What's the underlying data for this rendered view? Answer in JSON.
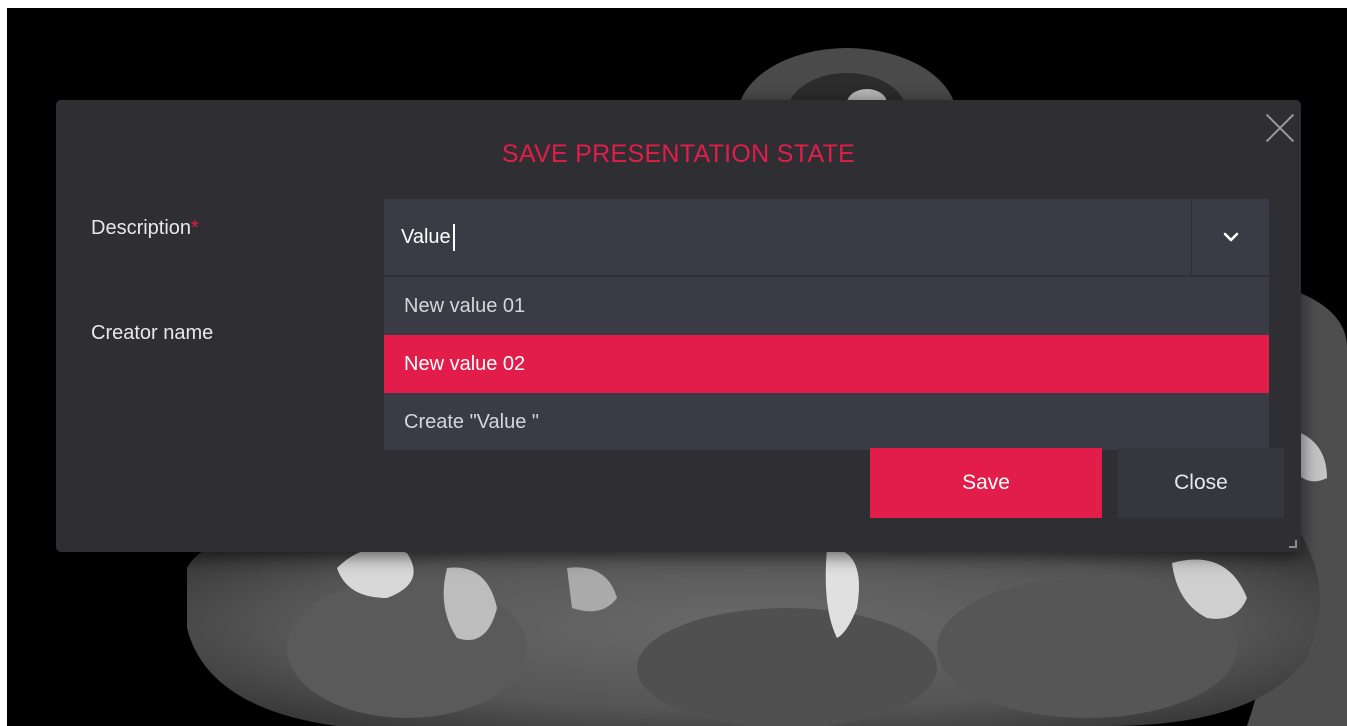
{
  "dialog": {
    "title": "SAVE PRESENTATION STATE",
    "close_icon": "close-icon",
    "accent_color": "#e31d4a"
  },
  "form": {
    "description_label": "Description",
    "required_marker": "*",
    "creator_label": "Creator name"
  },
  "description_combo": {
    "value": "Value",
    "dropdown_icon": "chevron-down-icon",
    "options": [
      {
        "label": "New value 01",
        "selected": false
      },
      {
        "label": "New value 02",
        "selected": true
      },
      {
        "label": "Create \"Value \"",
        "selected": false
      }
    ]
  },
  "buttons": {
    "save_label": "Save",
    "close_label": "Close"
  }
}
